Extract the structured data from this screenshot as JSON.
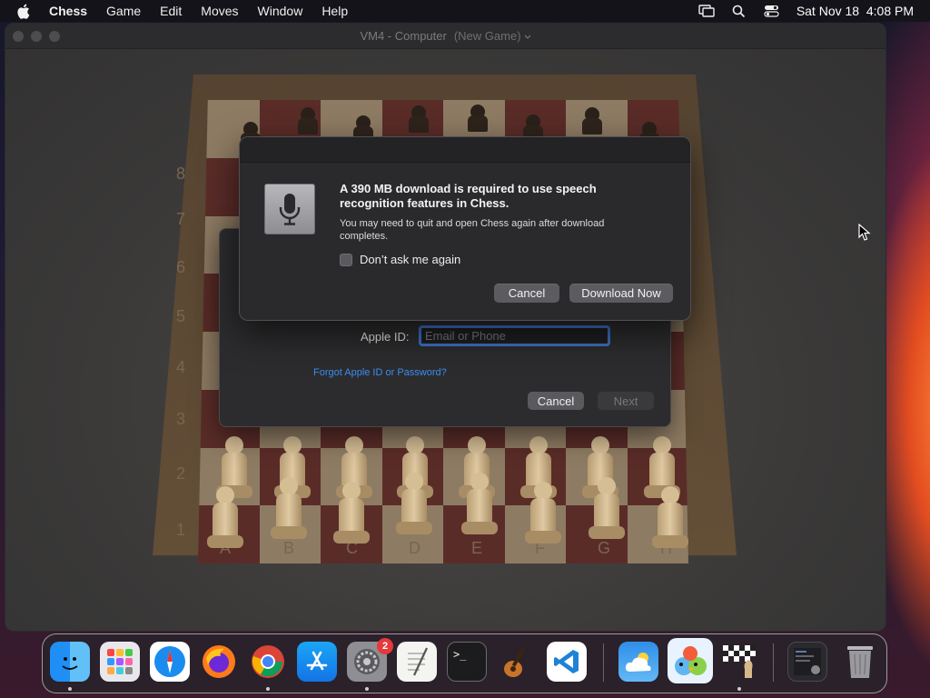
{
  "menubar": {
    "app_name": "Chess",
    "items": [
      "Game",
      "Edit",
      "Moves",
      "Window",
      "Help"
    ],
    "clock": "Sat Nov 18  4:08 PM"
  },
  "window": {
    "title": "VM4 - Computer",
    "subtitle": "(New Game)"
  },
  "board": {
    "ranks": [
      "8",
      "7",
      "6",
      "5",
      "4",
      "3",
      "2",
      "1"
    ],
    "files": [
      "A",
      "B",
      "C",
      "D",
      "E",
      "F",
      "G",
      "H"
    ]
  },
  "speech_dialog": {
    "title": "A 390 MB download is required to use speech recognition features in Chess.",
    "body": "You may need to quit and open Chess again after download completes.",
    "checkbox_label": "Don’t ask me again",
    "checkbox_checked": false,
    "cancel_label": "Cancel",
    "download_label": "Download Now",
    "icon": "microphone-icon"
  },
  "apple_id_dialog": {
    "label": "Apple ID:",
    "placeholder": "Email or Phone",
    "value": "",
    "forgot_link": "Forgot Apple ID or Password?",
    "cancel_label": "Cancel",
    "next_label": "Next"
  },
  "dock": {
    "items": [
      {
        "name": "Finder",
        "icon": "finder-icon"
      },
      {
        "name": "Launchpad",
        "icon": "launchpad-icon"
      },
      {
        "name": "Safari",
        "icon": "safari-icon"
      },
      {
        "name": "Firefox",
        "icon": "firefox-icon"
      },
      {
        "name": "Chrome",
        "icon": "chrome-icon"
      },
      {
        "name": "App Store",
        "icon": "app-store-icon"
      },
      {
        "name": "System Settings",
        "icon": "settings-icon",
        "badge": "2"
      },
      {
        "name": "TextEdit",
        "icon": "textedit-icon"
      },
      {
        "name": "Terminal",
        "icon": "terminal-icon"
      },
      {
        "name": "GarageBand",
        "icon": "garageband-icon"
      },
      {
        "name": "Visual Studio Code",
        "icon": "vscode-icon"
      },
      {
        "name": "Weather",
        "icon": "weather-icon"
      },
      {
        "name": "Game",
        "icon": "game-birds-icon"
      },
      {
        "name": "Chess",
        "icon": "chess-icon"
      },
      {
        "name": "Downloads",
        "icon": "downloads-stack-icon"
      },
      {
        "name": "Trash",
        "icon": "trash-icon"
      }
    ]
  },
  "colors": {
    "accent_blue": "#3b72c4",
    "link_blue": "#3b8ef0",
    "badge_red": "#e5393b"
  }
}
